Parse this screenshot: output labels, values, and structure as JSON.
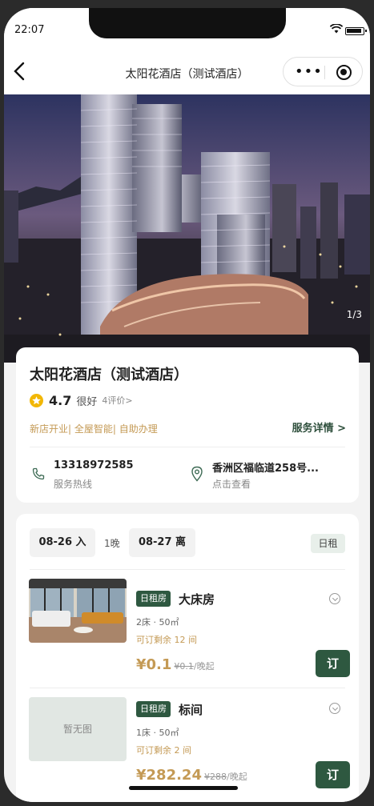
{
  "status_bar": {
    "time": "22:07"
  },
  "nav": {
    "title": "太阳花酒店（测试酒店）"
  },
  "hero": {
    "counter": "1/3"
  },
  "hotel": {
    "name": "太阳花酒店（测试酒店）",
    "score": "4.7",
    "rating_text": "很好",
    "review_link": "4评价>",
    "tags": "新店开业| 全屋智能| 自助办理",
    "service_link": "服务详情 >",
    "phone": "13318972585",
    "phone_label": "服务热线",
    "address": "香洲区福临道258号...",
    "address_label": "点击查看"
  },
  "booking": {
    "checkin": "08-26 入",
    "nights": "1晚",
    "checkout": "08-27 离",
    "rent_type": "日租"
  },
  "rooms": [
    {
      "badge": "日租房",
      "name": "大床房",
      "spec": "2床 · 50㎡",
      "availability": "可订剩余 12 间",
      "price": "¥0.1",
      "original_price": "¥0.1",
      "per_night": "/晚起",
      "book_label": "订"
    },
    {
      "badge": "日租房",
      "name": "标间",
      "spec": "1床 · 50㎡",
      "availability": "可订剩余 2 间",
      "price": "¥282.24",
      "original_price": "¥288",
      "per_night": "/晚起",
      "book_label": "订",
      "no_image": "暂无图"
    }
  ],
  "colors": {
    "accent_green": "#2e5840",
    "gold": "#c49a55",
    "star": "#f2b705"
  }
}
